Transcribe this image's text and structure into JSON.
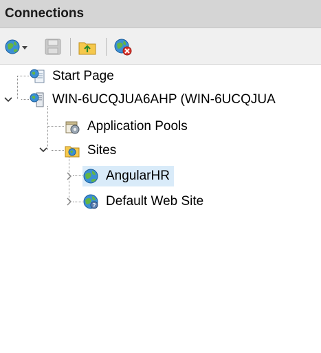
{
  "panel": {
    "title": "Connections"
  },
  "toolbar": {
    "buttons": [
      {
        "name": "connect-icon"
      },
      {
        "name": "save-icon"
      },
      {
        "name": "up-folder-icon"
      },
      {
        "name": "disconnect-icon"
      }
    ]
  },
  "tree": {
    "start_page": "Start Page",
    "server": "WIN-6UCQJUA6AHP (WIN-6UCQJUA",
    "app_pools": "Application Pools",
    "sites": "Sites",
    "site_items": [
      "AngularHR",
      "Default Web Site"
    ],
    "selected": "AngularHR"
  },
  "colors": {
    "header_bg": "#d5d5d5",
    "toolbar_bg": "#f0f0f0",
    "selection_bg": "#d9ebf9"
  }
}
